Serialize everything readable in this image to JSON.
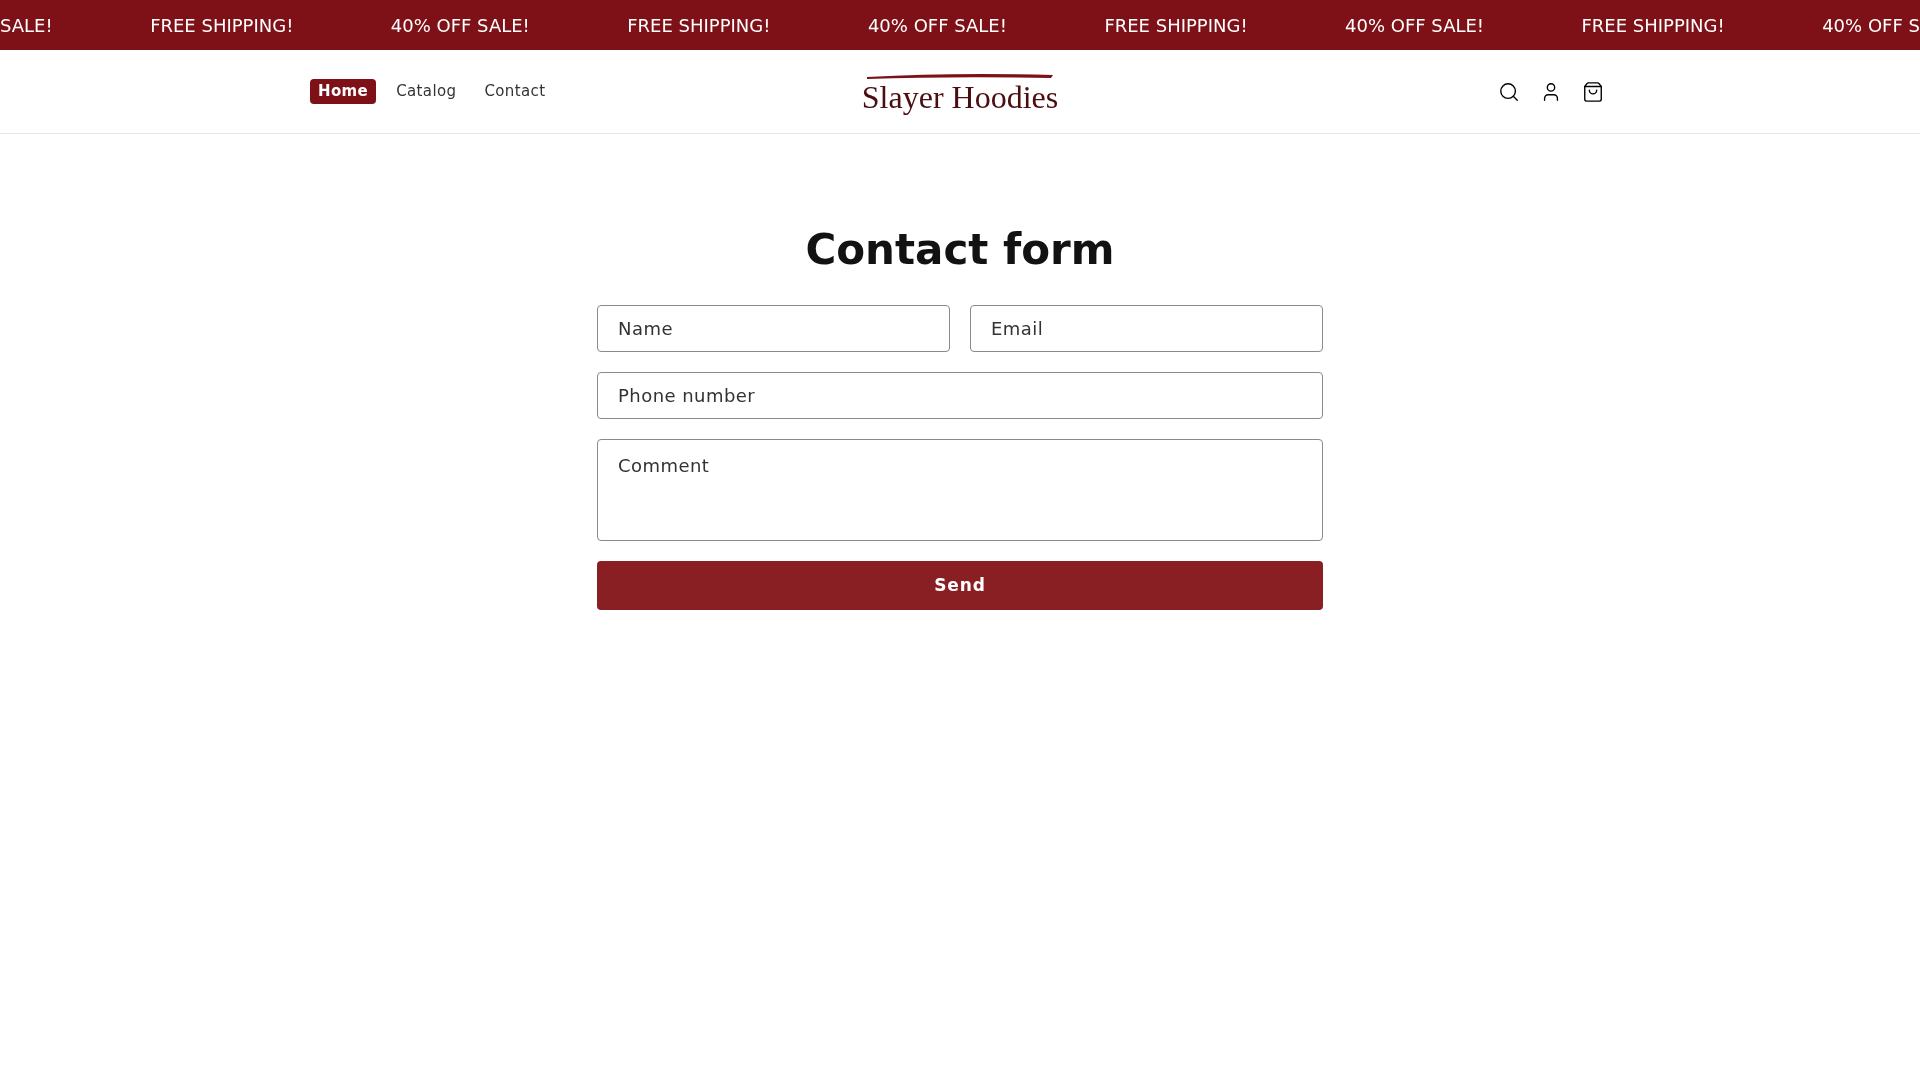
{
  "announcement_bar": [
    "SALE!",
    "FREE SHIPPING!",
    "40% OFF SALE!",
    "FREE SHIPPING!",
    "40% OFF SALE!",
    "FREE SHIPPING!",
    "40% OFF SALE!",
    "FREE SHIPPING!",
    "40% OFF S"
  ],
  "nav": [
    {
      "label": "Home",
      "selected": true
    },
    {
      "label": "Catalog",
      "selected": false
    },
    {
      "label": "Contact",
      "selected": false
    }
  ],
  "logo": "Slayer Hoodies",
  "form": {
    "title": "Contact form",
    "fields": [
      {
        "placeholder": "Name",
        "kind": "input"
      },
      {
        "placeholder": "Email",
        "kind": "input"
      },
      {
        "placeholder": "Phone number",
        "kind": "input"
      },
      {
        "placeholder": "Comment",
        "kind": "textarea"
      }
    ],
    "submit": "Send"
  }
}
